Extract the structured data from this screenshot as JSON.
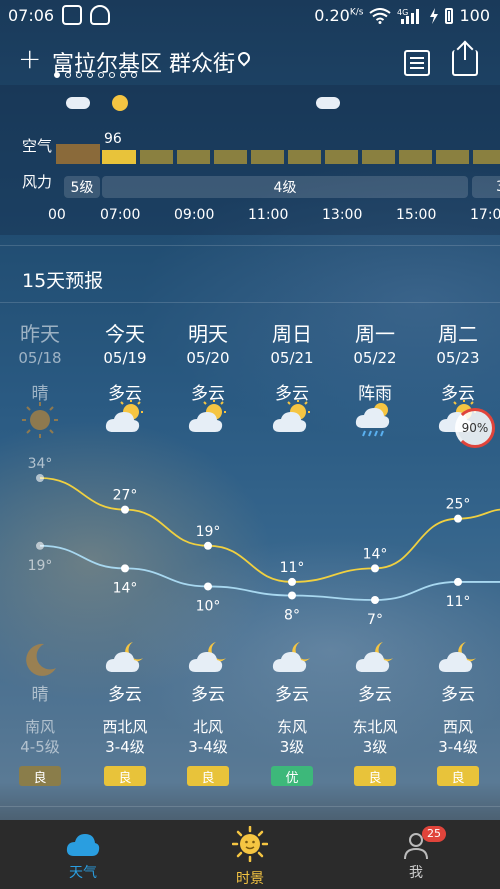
{
  "status_bar": {
    "time": "07:06",
    "speed": "0.20",
    "speed_unit": "K/s",
    "network": "4G",
    "battery": "100"
  },
  "header": {
    "city": "富拉尔基区 群众街",
    "page_dots_total": 8,
    "page_dots_active": 1
  },
  "hourly": {
    "aqi_label": "空气",
    "aqi_value": "96",
    "wind_label": "风力",
    "wind_segments": [
      "5级",
      "4级",
      "3"
    ],
    "time_ticks": [
      "00",
      "07:00",
      "09:00",
      "11:00",
      "13:00",
      "15:00",
      "17:0"
    ]
  },
  "forecast": {
    "title": "15天预报",
    "days": [
      {
        "day": "昨天",
        "date": "05/18",
        "day_cond": "晴",
        "day_icon": "sun-icon",
        "night_cond": "晴",
        "night_icon": "moon-icon",
        "wind_dir": "南风",
        "wind_level": "4-5级",
        "aqi": "良",
        "high": "34°",
        "low": "19°"
      },
      {
        "day": "今天",
        "date": "05/19",
        "day_cond": "多云",
        "day_icon": "partly-cloudy-icon",
        "night_cond": "多云",
        "night_icon": "cloudy-night-icon",
        "wind_dir": "西北风",
        "wind_level": "3-4级",
        "aqi": "良",
        "high": "27°",
        "low": "14°"
      },
      {
        "day": "明天",
        "date": "05/20",
        "day_cond": "多云",
        "day_icon": "partly-cloudy-icon",
        "night_cond": "多云",
        "night_icon": "cloudy-night-icon",
        "wind_dir": "北风",
        "wind_level": "3-4级",
        "aqi": "良",
        "high": "19°",
        "low": "10°"
      },
      {
        "day": "周日",
        "date": "05/21",
        "day_cond": "多云",
        "day_icon": "partly-cloudy-icon",
        "night_cond": "多云",
        "night_icon": "cloudy-night-icon",
        "wind_dir": "东风",
        "wind_level": "3级",
        "aqi": "优",
        "high": "11°",
        "low": "8°"
      },
      {
        "day": "周一",
        "date": "05/22",
        "day_cond": "阵雨",
        "day_icon": "shower-icon",
        "night_cond": "多云",
        "night_icon": "cloudy-night-icon",
        "wind_dir": "东北风",
        "wind_level": "3级",
        "aqi": "良",
        "high": "14°",
        "low": "7°"
      },
      {
        "day": "周二",
        "date": "05/23",
        "day_cond": "多云",
        "day_icon": "partly-cloudy-icon",
        "night_cond": "多云",
        "night_icon": "cloudy-night-icon",
        "wind_dir": "西风",
        "wind_level": "3-4级",
        "aqi": "良",
        "high": "25°",
        "low": "11°",
        "rain_prob": "90%"
      }
    ]
  },
  "colors": {
    "aqi_good": "#e8c33a",
    "aqi_excellent": "#3db87a",
    "aqi_past": "#8a7d4a",
    "high_line": "#f0d040",
    "low_line": "#a8d8f0",
    "nav_active": "#f5c542",
    "nav_weather": "#2a9ee0"
  },
  "bottom_nav": {
    "weather": "天气",
    "timeline": "时景",
    "me": "我",
    "me_badge": "25"
  }
}
